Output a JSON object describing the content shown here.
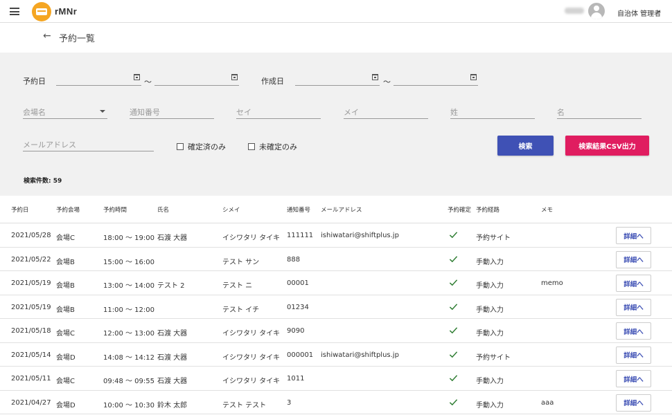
{
  "header": {
    "brand": "rMNr",
    "role_label": "自治体 管理者"
  },
  "page": {
    "title": "予約一覧"
  },
  "filters": {
    "reservation_date_label": "予約日",
    "created_date_label": "作成日",
    "range_separator": "～",
    "venue_placeholder": "会場名",
    "notice_no_placeholder": "通知番号",
    "sei_kana_placeholder": "セイ",
    "mei_kana_placeholder": "メイ",
    "last_name_placeholder": "姓",
    "first_name_placeholder": "名",
    "email_placeholder": "メールアドレス",
    "confirmed_only_label": "確定済のみ",
    "unconfirmed_only_label": "未確定のみ",
    "search_button": "検索",
    "csv_button": "検索結果CSV出力"
  },
  "results": {
    "count_label": "検索件数: 59"
  },
  "table": {
    "columns": [
      "予約日",
      "予約会場",
      "予約時間",
      "氏名",
      "シメイ",
      "通知番号",
      "メールアドレス",
      "予約確定",
      "予約経路",
      "メモ"
    ],
    "detail_label": "詳細へ",
    "rows": [
      {
        "date": "2021/05/28",
        "venue": "会場C",
        "time": "18:00 ～ 19:00",
        "name": "石渡 大器",
        "kana": "イシワタリ タイキ",
        "notice": "111111",
        "email": "ishiwatari@shiftplus.jp",
        "confirmed": true,
        "route": "予約サイト",
        "memo": ""
      },
      {
        "date": "2021/05/22",
        "venue": "会場B",
        "time": "15:00 ～ 16:00",
        "name": "",
        "kana": "テスト サン",
        "notice": "888",
        "email": "",
        "confirmed": true,
        "route": "手動入力",
        "memo": ""
      },
      {
        "date": "2021/05/19",
        "venue": "会場B",
        "time": "13:00 ～ 14:00",
        "name": "テスト 2",
        "kana": "テスト ニ",
        "notice": "00001",
        "email": "",
        "confirmed": true,
        "route": "手動入力",
        "memo": "memo"
      },
      {
        "date": "2021/05/19",
        "venue": "会場B",
        "time": "11:00 ～ 12:00",
        "name": "",
        "kana": "テスト イチ",
        "notice": "01234",
        "email": "",
        "confirmed": true,
        "route": "手動入力",
        "memo": ""
      },
      {
        "date": "2021/05/18",
        "venue": "会場C",
        "time": "12:00 ～ 13:00",
        "name": "石渡 大器",
        "kana": "イシワタリ タイキ",
        "notice": "9090",
        "email": "",
        "confirmed": true,
        "route": "手動入力",
        "memo": ""
      },
      {
        "date": "2021/05/14",
        "venue": "会場D",
        "time": "14:08 ～ 14:12",
        "name": "石渡 大器",
        "kana": "イシワタリ タイキ",
        "notice": "000001",
        "email": "ishiwatari@shiftplus.jp",
        "confirmed": true,
        "route": "予約サイト",
        "memo": ""
      },
      {
        "date": "2021/05/11",
        "venue": "会場C",
        "time": "09:48 ～ 09:55",
        "name": "石渡 大器",
        "kana": "イシワタリ タイキ",
        "notice": "1011",
        "email": "",
        "confirmed": true,
        "route": "手動入力",
        "memo": ""
      },
      {
        "date": "2021/04/27",
        "venue": "会場D",
        "time": "10:00 ～ 10:30",
        "name": "鈴木 太郎",
        "kana": "テスト テスト",
        "notice": "3",
        "email": "",
        "confirmed": true,
        "route": "手動入力",
        "memo": "aaa"
      }
    ]
  },
  "colors": {
    "primary": "#3f51b5",
    "accent": "#e01d60",
    "logo": "#f5a623",
    "check": "#2e7d32"
  }
}
